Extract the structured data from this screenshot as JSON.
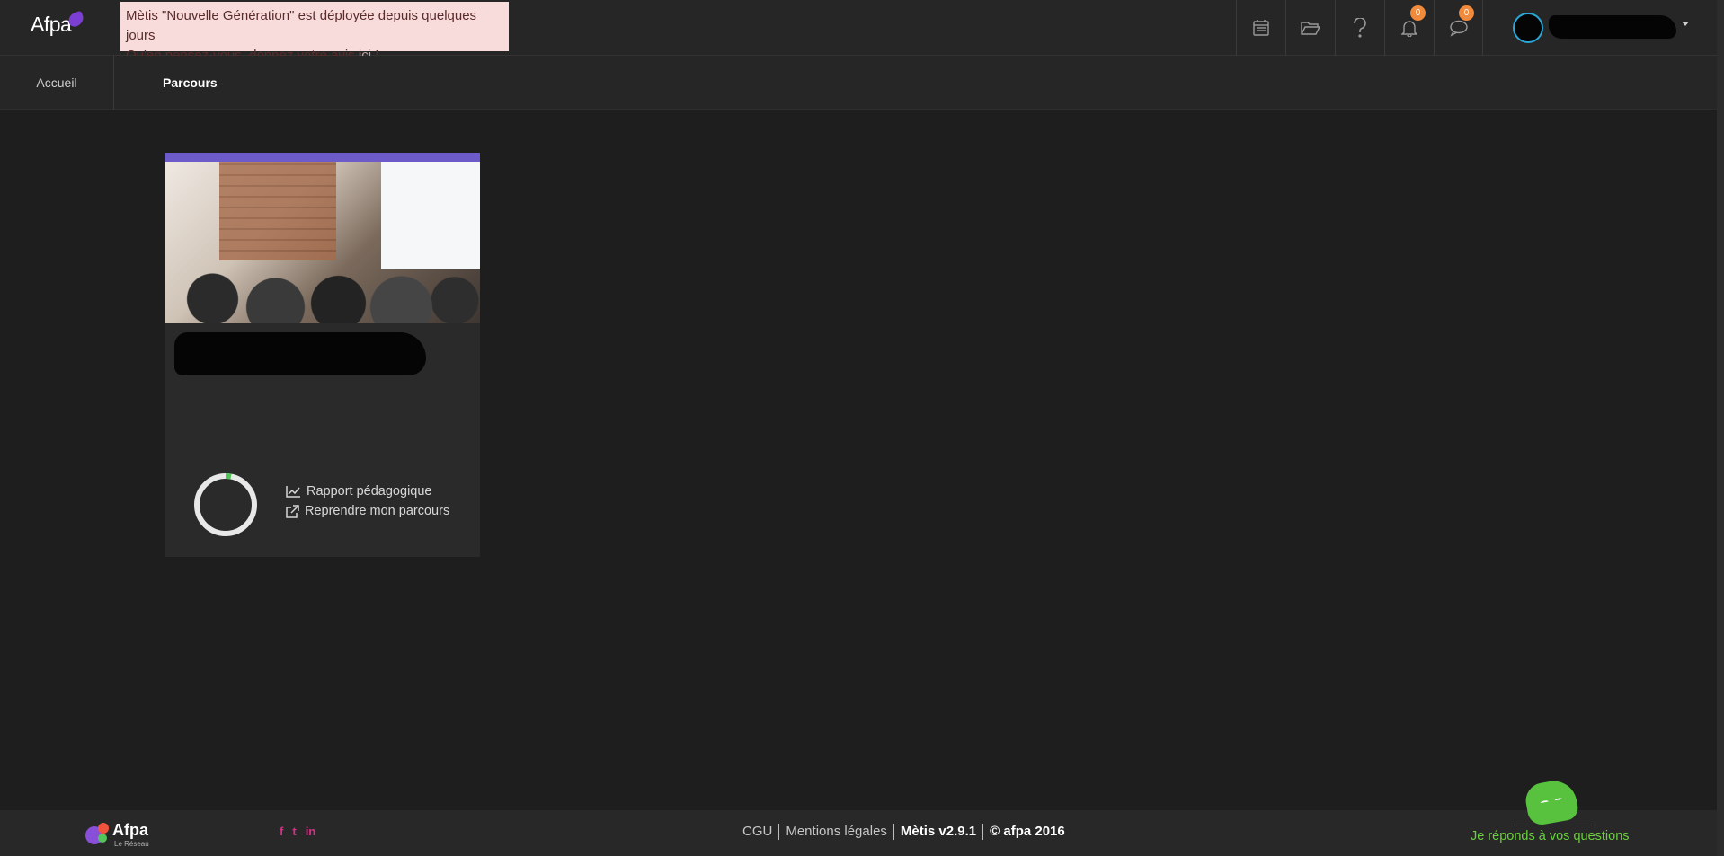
{
  "header": {
    "logo": "Afpa",
    "notice": {
      "line1": "Mètis \"Nouvelle Génération\" est déployée depuis quelques jours",
      "line2_prefix": "Qu'en pensez-vous, donnez votre avis ",
      "link": "ici",
      "line2_suffix": " !"
    },
    "icons": [
      {
        "name": "calendar-icon"
      },
      {
        "name": "folder-icon"
      },
      {
        "name": "help-icon"
      },
      {
        "name": "bell-icon",
        "badge": "0"
      },
      {
        "name": "chat-icon",
        "badge": "0"
      }
    ]
  },
  "nav": {
    "home": "Accueil",
    "parcours": "Parcours"
  },
  "card": {
    "links": {
      "report": "Rapport pédagogique",
      "resume": "Reprendre mon parcours"
    },
    "progress": 0.03
  },
  "footer": {
    "brand": "Afpa",
    "brand_sub": "Le Réseau",
    "social": [
      "f",
      "t",
      "in"
    ],
    "links": [
      "CGU",
      "Mentions légales",
      "Mètis v2.9.1",
      "© afpa 2016"
    ],
    "assistant": "Je réponds à vos questions"
  },
  "colors": {
    "accent": "#6c5bc8",
    "badge": "#f08a3c",
    "progress": "#52c45a",
    "social": "#d62f86",
    "assistant": "#6ad13d"
  }
}
